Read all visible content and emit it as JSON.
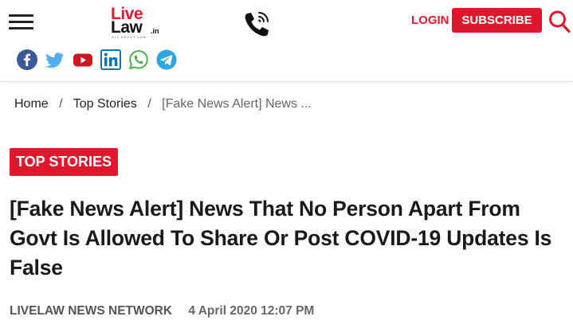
{
  "header": {
    "logo": {
      "line1": "Live",
      "line2": "Law",
      "suffix": ".in",
      "tagline": "ALL ABOUT LAW"
    },
    "login_label": "LOGIN",
    "subscribe_label": "SUBSCRIBE"
  },
  "social": [
    "facebook-icon",
    "twitter-icon",
    "youtube-icon",
    "linkedin-icon",
    "whatsapp-icon",
    "telegram-icon"
  ],
  "breadcrumb": {
    "home": "Home",
    "section": "Top Stories",
    "current": "[Fake News Alert] News ...",
    "separator": "/"
  },
  "article": {
    "category": "TOP STORIES",
    "title": "[Fake News Alert] News That No Person Apart From Govt Is Allowed To Share Or Post COVID-19 Updates Is False",
    "author": "LIVELAW NEWS NETWORK",
    "date": "4 April 2020 12:07 PM"
  },
  "colors": {
    "brand_red": "#e0182d",
    "facebook": "#3b5998",
    "twitter": "#55acee",
    "youtube": "#cc181e",
    "linkedin": "#0077b5",
    "whatsapp": "#4caf50",
    "telegram": "#2ca5e0"
  }
}
